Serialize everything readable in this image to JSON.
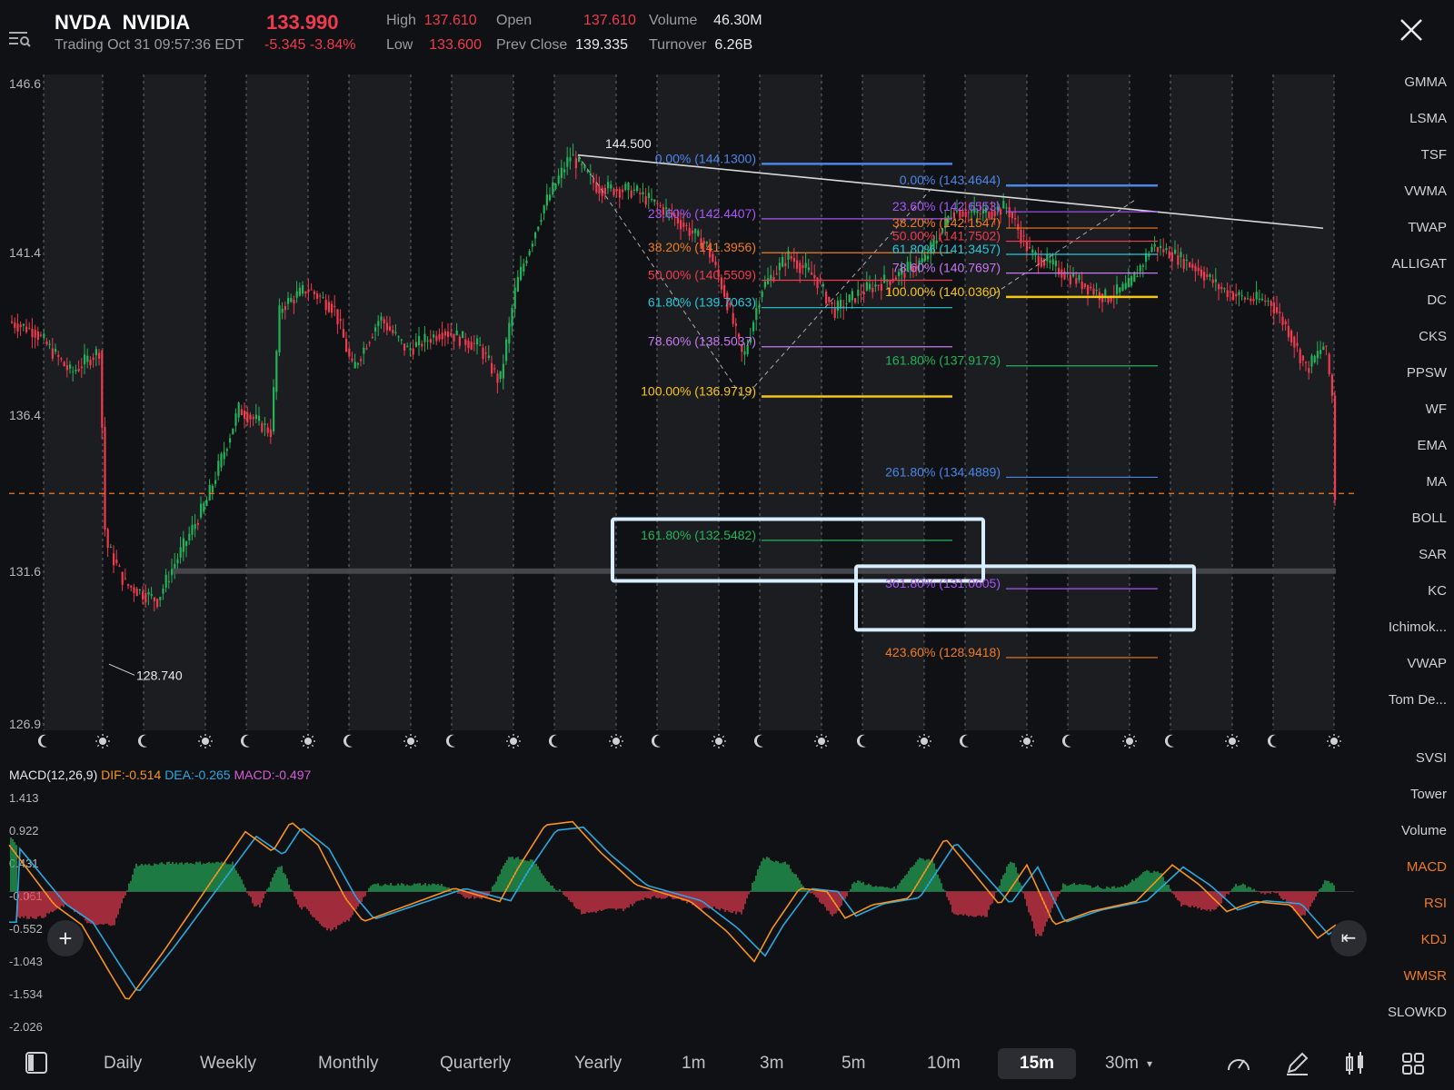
{
  "header": {
    "symbol": "NVDA",
    "name": "NVIDIA",
    "price": "133.990",
    "status": "Trading Oct 31 09:57:36 EDT",
    "change": "-5.345",
    "change_pct": "-3.84%",
    "high_label": "High",
    "high_value": "137.610",
    "low_label": "Low",
    "low_value": "133.600",
    "open_label": "Open",
    "open_value": "137.610",
    "prev_close_label": "Prev Close",
    "prev_close_value": "139.335",
    "volume_label": "Volume",
    "volume_value": "46.30M",
    "turnover_label": "Turnover",
    "turnover_value": "6.26B"
  },
  "main_chart": {
    "y_ticks": [
      "146.6",
      "141.4",
      "136.4",
      "131.6",
      "126.9"
    ],
    "high_marker": "144.500",
    "low_marker": "128.740",
    "fib_left": [
      {
        "label": "0.00% (144.1300)",
        "color": "#4a86e8"
      },
      {
        "label": "23.60% (142.4407)",
        "color": "#a855f7"
      },
      {
        "label": "38.20% (141.3956)",
        "color": "#f07b20"
      },
      {
        "label": "50.00% (140.5509)",
        "color": "#ef3a4f"
      },
      {
        "label": "61.80% (139.7063)",
        "color": "#26c6da"
      },
      {
        "label": "78.60% (138.5037)",
        "color": "#c678f0"
      },
      {
        "label": "100.00% (136.9719)",
        "color": "#f5c518"
      },
      {
        "label": "161.80% (132.5482)",
        "color": "#22b35a"
      }
    ],
    "fib_right": [
      {
        "label": "0.00% (143.4644)",
        "color": "#4a86e8"
      },
      {
        "label": "23.60% (142.6553)",
        "color": "#a855f7"
      },
      {
        "label": "38.20% (142.1547)",
        "color": "#f07b20"
      },
      {
        "label": "50.00% (141.7502)",
        "color": "#ef3a4f"
      },
      {
        "label": "61.80% (141.3457)",
        "color": "#26c6da"
      },
      {
        "label": "78.60% (140.7697)",
        "color": "#c678f0"
      },
      {
        "label": "100.00% (140.0360)",
        "color": "#f5c518"
      },
      {
        "label": "161.80% (137.9173)",
        "color": "#22b35a"
      },
      {
        "label": "261.80% (134.4889)",
        "color": "#4a86e8"
      },
      {
        "label": "361.80% (131.0605)",
        "color": "#a855f7"
      },
      {
        "label": "423.60% (128.9418)",
        "color": "#f07b20"
      }
    ]
  },
  "macd": {
    "title": "MACD(12,26,9)",
    "dif": "DIF:-0.514",
    "dea": "DEA:-0.265",
    "macd": "MACD:-0.497",
    "y_ticks": [
      "1.413",
      "0.922",
      "0.431",
      "-0.061",
      "-0.552",
      "-1.043",
      "-1.534",
      "-2.026"
    ]
  },
  "indicators_main": [
    "GMMA",
    "LSMA",
    "TSF",
    "VWMA",
    "TWAP",
    "ALLIGAT",
    "DC",
    "CKS",
    "PPSW",
    "WF",
    "EMA",
    "MA",
    "BOLL",
    "SAR",
    "KC",
    "Ichimok...",
    "VWAP",
    "Tom De..."
  ],
  "indicators_sub": [
    "SVSI",
    "Tower",
    "Volume",
    "MACD",
    "RSI",
    "KDJ",
    "WMSR",
    "SLOWKD"
  ],
  "timeframes": [
    "Daily",
    "Weekly",
    "Monthly",
    "Quarterly",
    "Yearly",
    "1m",
    "3m",
    "5m",
    "10m",
    "15m",
    "30m"
  ],
  "active_timeframe": "15m",
  "colors": {
    "up": "#22b35a",
    "down": "#ef3a4f",
    "dif": "#f7931e",
    "dea": "#29a8e0",
    "macd": "#d65cd6",
    "highlight_box": "#d8eefe",
    "price_line": "#f07b20"
  }
}
